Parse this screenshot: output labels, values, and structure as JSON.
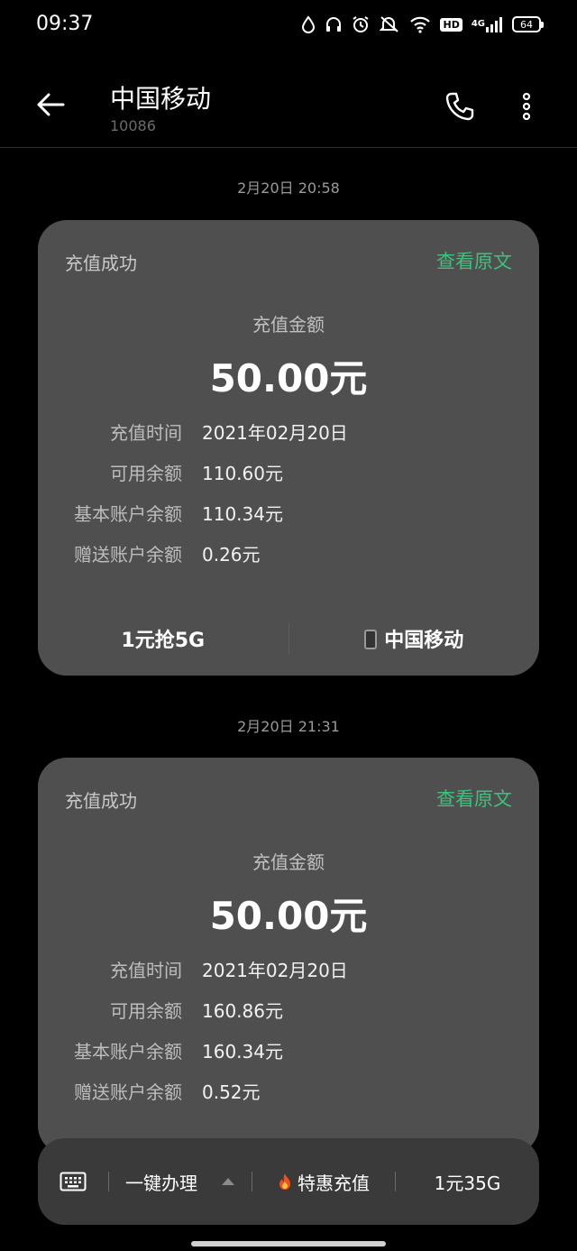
{
  "status_bar": {
    "time": "09:37",
    "network": "4G",
    "hd": "HD",
    "battery": "64",
    "icons": [
      "water-drop-icon",
      "headphones-icon",
      "alarm-icon",
      "mute-icon",
      "wifi-icon",
      "hd-icon",
      "signal-icon",
      "battery-icon"
    ]
  },
  "header": {
    "title": "中国移动",
    "number": "10086"
  },
  "messages": [
    {
      "timestamp": "2月20日 20:58",
      "title": "充值成功",
      "view_original": "查看原文",
      "amount_label": "充值金额",
      "amount": "50.00元",
      "details": [
        {
          "label": "充值时间",
          "value": "2021年02月20日"
        },
        {
          "label": "可用余额",
          "value": "110.60元"
        },
        {
          "label": "基本账户余额",
          "value": "110.34元"
        },
        {
          "label": "赠送账户余额",
          "value": "0.26元"
        }
      ],
      "actions": [
        "1元抢5G",
        "中国移动"
      ]
    },
    {
      "timestamp": "2月20日 21:31",
      "title": "充值成功",
      "view_original": "查看原文",
      "amount_label": "充值金额",
      "amount": "50.00元",
      "details": [
        {
          "label": "充值时间",
          "value": "2021年02月20日"
        },
        {
          "label": "可用余额",
          "value": "160.86元"
        },
        {
          "label": "基本账户余额",
          "value": "160.34元"
        },
        {
          "label": "赠送账户余额",
          "value": "0.52元"
        }
      ]
    }
  ],
  "bottom_bar": {
    "one_key": "一键办理",
    "recharge": "特惠充值",
    "data_plan": "1元35G"
  },
  "colors": {
    "accent": "#3ec17c",
    "card": "#4f4f4f",
    "background": "#000000"
  }
}
